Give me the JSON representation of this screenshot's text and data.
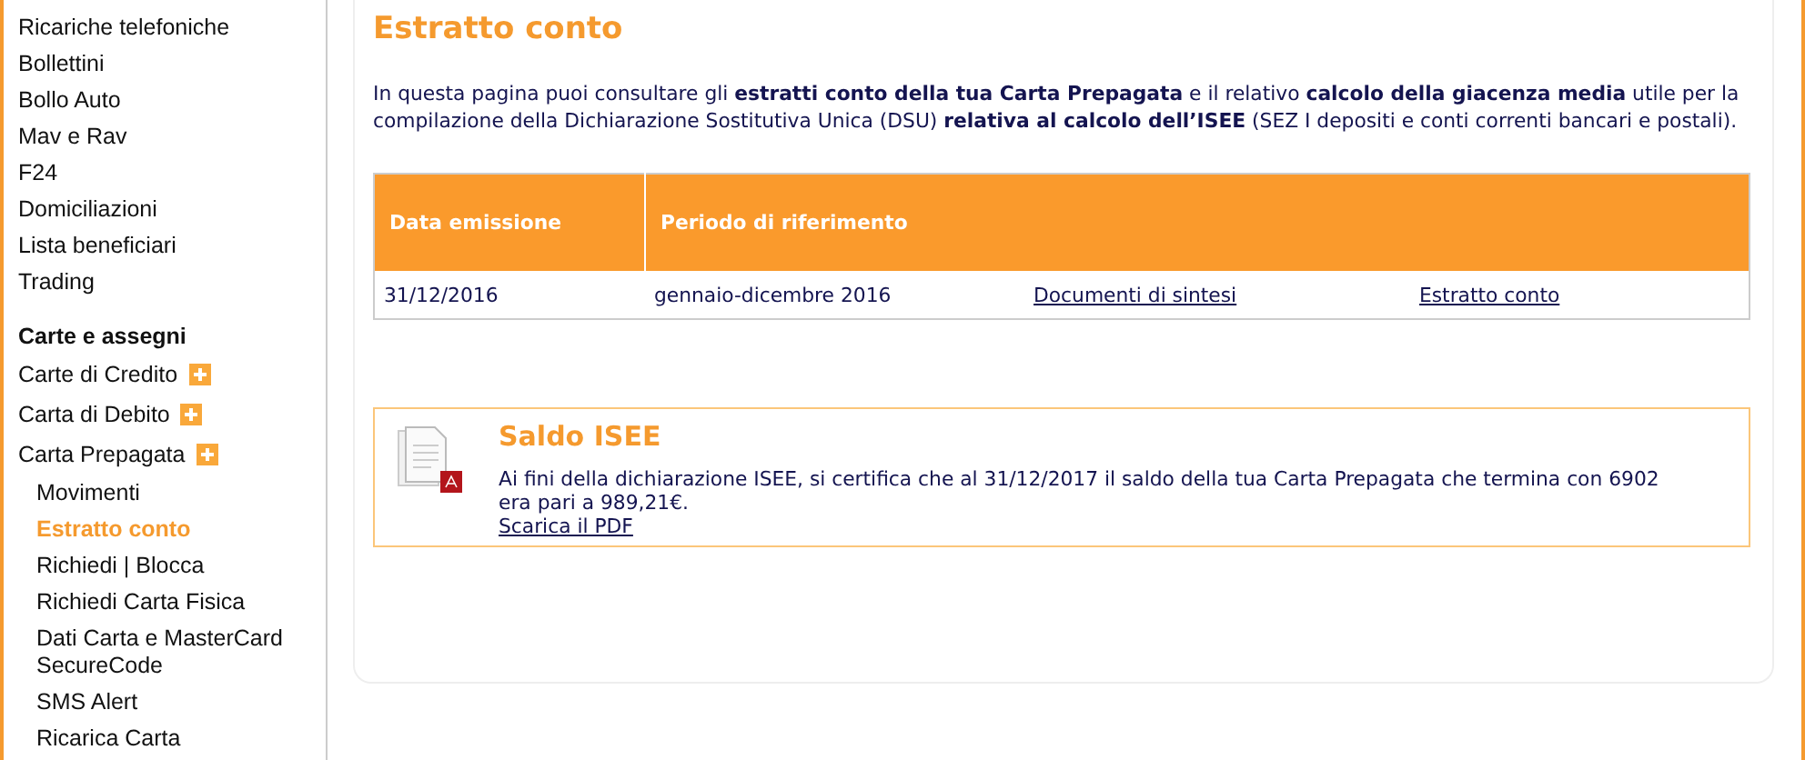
{
  "sidebar": {
    "items": [
      {
        "kind": "link",
        "label": "Ricariche telefoniche"
      },
      {
        "kind": "link",
        "label": "Bollettini"
      },
      {
        "kind": "link",
        "label": "Bollo Auto"
      },
      {
        "kind": "link",
        "label": "Mav e Rav"
      },
      {
        "kind": "link",
        "label": "F24"
      },
      {
        "kind": "link",
        "label": "Domiciliazioni"
      },
      {
        "kind": "link",
        "label": "Lista beneficiari"
      },
      {
        "kind": "link",
        "label": "Trading"
      },
      {
        "kind": "heading",
        "label": "Carte e assegni"
      },
      {
        "kind": "expandable",
        "label": "Carte di Credito"
      },
      {
        "kind": "expandable",
        "label": "Carta di Debito"
      },
      {
        "kind": "expandable",
        "label": "Carta Prepagata",
        "children": [
          {
            "label": "Movimenti",
            "selected": false
          },
          {
            "label": "Estratto conto",
            "selected": true
          },
          {
            "label": "Richiedi | Blocca",
            "selected": false
          },
          {
            "label": "Richiedi Carta Fisica",
            "selected": false
          },
          {
            "label": "Dati Carta e MasterCard SecureCode",
            "selected": false
          },
          {
            "label": "SMS Alert",
            "selected": false
          },
          {
            "label": "Ricarica Carta",
            "selected": false
          }
        ]
      }
    ]
  },
  "page": {
    "title": "Estratto conto",
    "intro": "In questa pagina puoi consultare gli **estratti conto della tua Carta Prepagata** e il relativo **calcolo della giacenza media** utile per la compilazione della Dichiarazione Sostitutiva Unica (DSU) **relativa al calcolo dell’ISEE** (SEZ I depositi e conti correnti bancari e postali)."
  },
  "table": {
    "columns": [
      "Data emissione",
      "Periodo di riferimento"
    ],
    "rows": [
      {
        "cells": [
          {
            "kind": "text",
            "text": "31/12/2016"
          },
          {
            "kind": "text",
            "text": "gennaio-dicembre 2016"
          },
          {
            "kind": "link",
            "text": "Documenti di sintesi"
          },
          {
            "kind": "link",
            "text": "Estratto conto"
          }
        ]
      }
    ]
  },
  "isee": {
    "title": "Saldo ISEE",
    "text": "Ai fini della dichiarazione ISEE, si certifica che al 31/12/2017 il saldo della tua Carta Prepagata che termina con 6902 era pari a 989,21€.",
    "link": "Scarica il PDF"
  }
}
